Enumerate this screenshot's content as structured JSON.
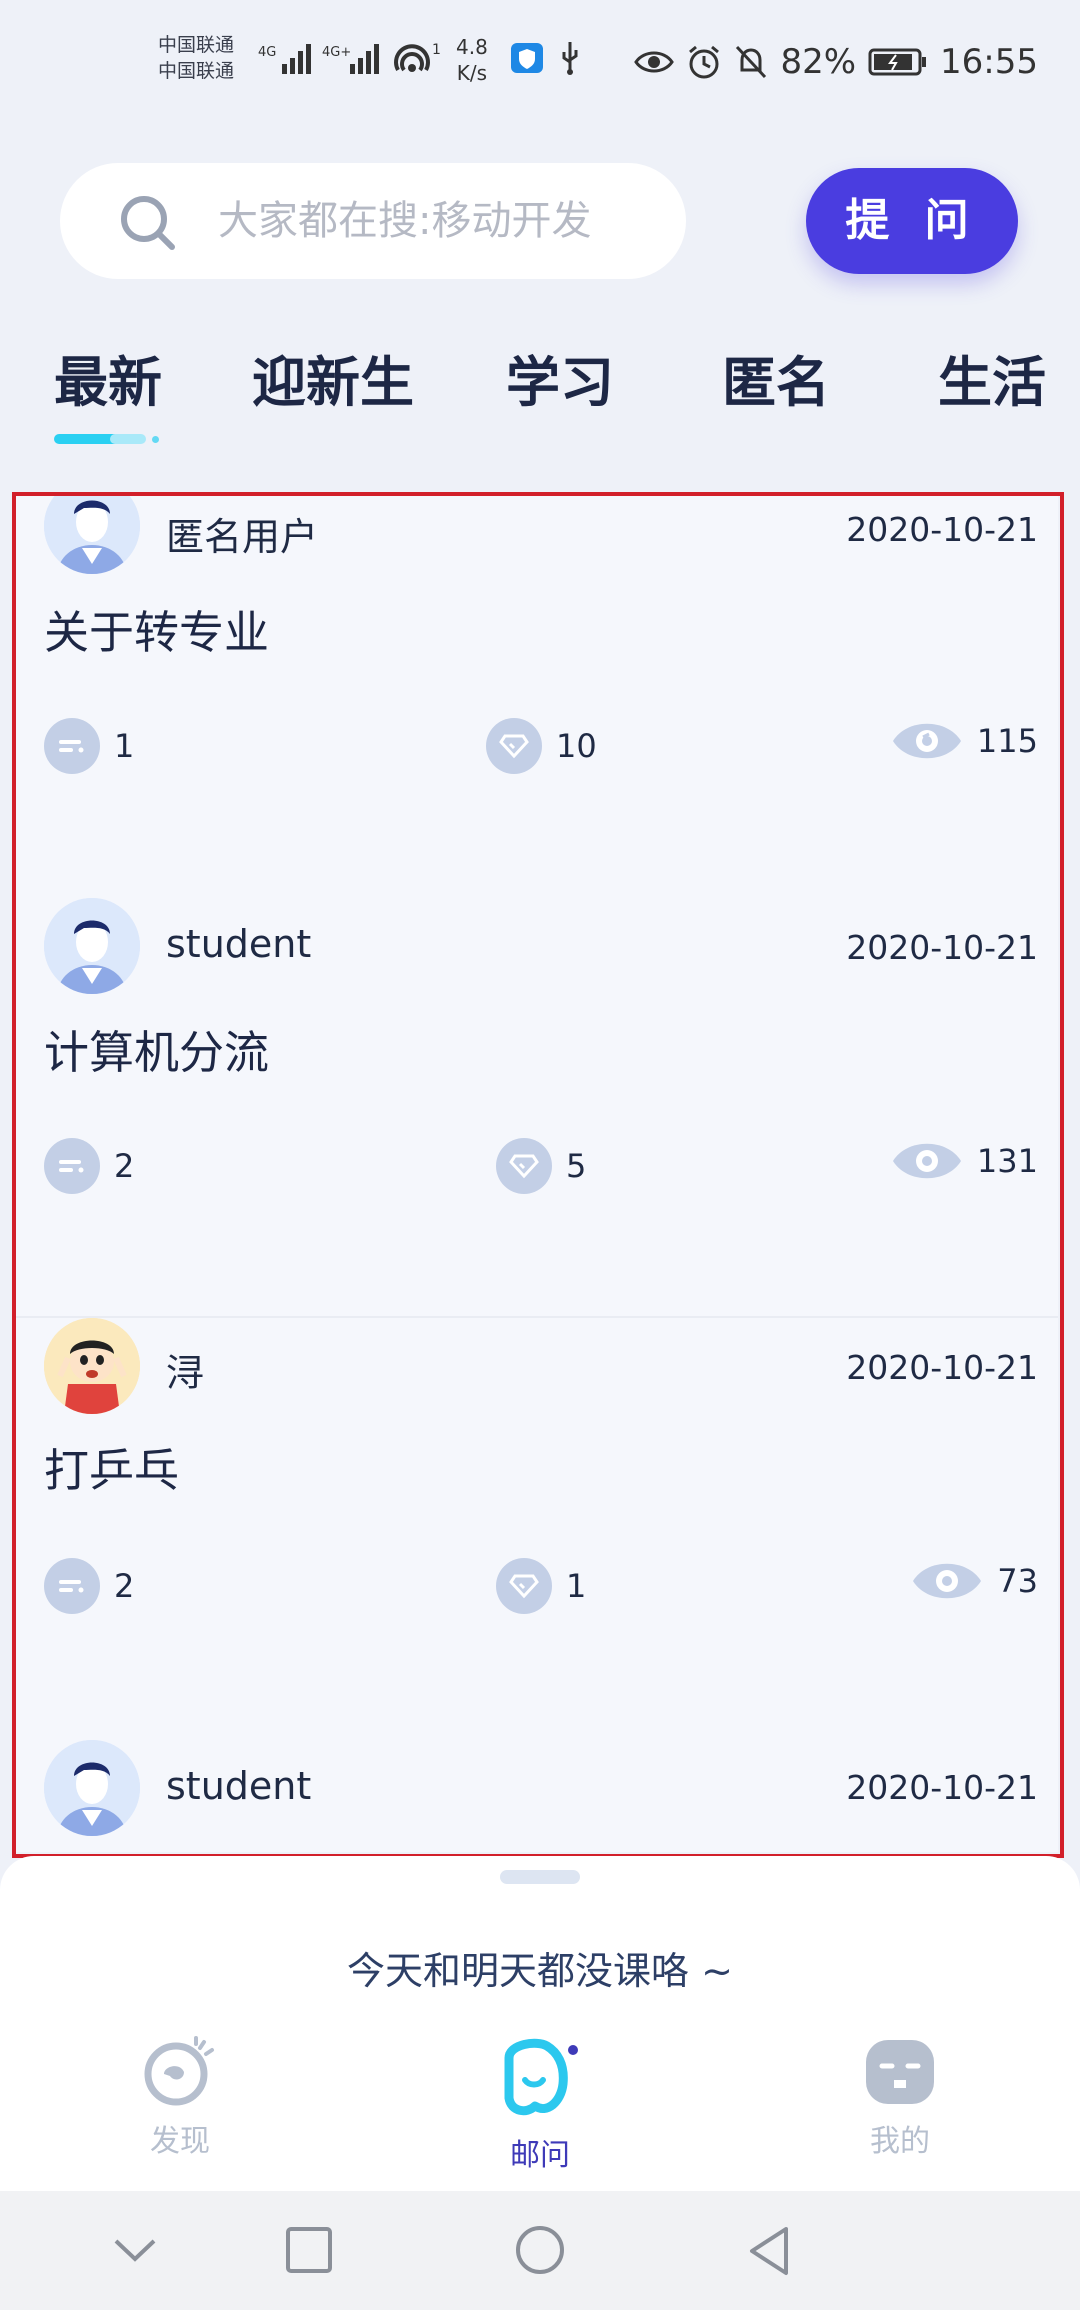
{
  "status_bar": {
    "carrier1": "中国联通",
    "carrier2": "中国联通",
    "net1": "4G",
    "net2": "4G+",
    "hotspot_count": "1",
    "speed_value": "4.8",
    "speed_unit": "K/s",
    "battery": "82%",
    "time": "16:55"
  },
  "search": {
    "placeholder": "大家都在搜:移动开发",
    "icon": "search-icon"
  },
  "ask_button": "提 问",
  "tabs": [
    "最新",
    "迎新生",
    "学习",
    "匿名",
    "生活"
  ],
  "active_tab": "最新",
  "posts": [
    {
      "user": "匿名用户",
      "date": "2020-10-21",
      "title": "关于转专业",
      "answers": "1",
      "likes": "10",
      "views": "115",
      "avatar": "boy-avatar"
    },
    {
      "user": "student",
      "date": "2020-10-21",
      "title": "计算机分流",
      "answers": "2",
      "likes": "5",
      "views": "131",
      "avatar": "boy-avatar"
    },
    {
      "user": "浔",
      "date": "2020-10-21",
      "title": "打乒乓",
      "answers": "2",
      "likes": "1",
      "views": "73",
      "avatar": "crayon-kid-avatar"
    },
    {
      "user": "student",
      "date": "2020-10-21",
      "title": "",
      "answers": "",
      "likes": "",
      "views": "",
      "avatar": "boy-avatar"
    }
  ],
  "bottom_sheet": {
    "message": "今天和明天都没课咯 ~"
  },
  "bottom_nav": [
    {
      "label": "发现",
      "icon": "discover-icon"
    },
    {
      "label": "邮问",
      "icon": "ask-icon"
    },
    {
      "label": "我的",
      "icon": "profile-icon"
    }
  ],
  "colors": {
    "accent": "#4a3de0",
    "tab_indicator": "#2ad0f2",
    "highlight_frame": "#d21f2a"
  }
}
